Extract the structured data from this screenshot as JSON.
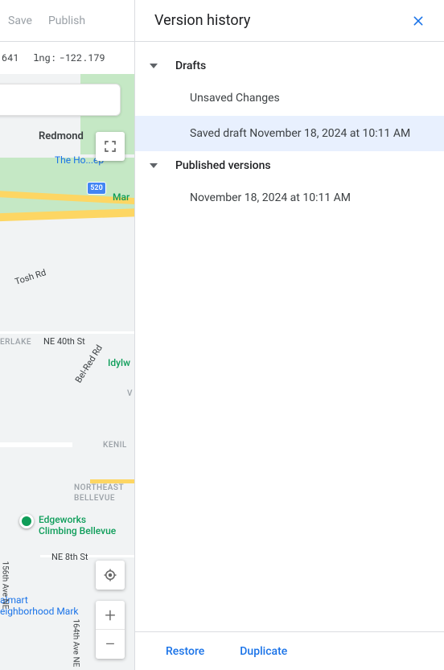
{
  "toolbar": {
    "save_label": "Save",
    "publish_label": "Publish"
  },
  "coords": {
    "lat_value": "641",
    "lng_label": "lng:",
    "lng_value": "-122.179"
  },
  "map": {
    "city": "Redmond",
    "poi_home_depot": "The Ho...ep",
    "poi_marymoor": "Mar",
    "route_520": "520",
    "road_tosh": "Tosh Rd",
    "neighborhood_erlake": "ERLAKE",
    "road_ne40": "NE 40th St",
    "road_belred": "Bel‑Red Rd",
    "poi_idylw": "Idylw",
    "neighborhood_v": "V",
    "neighborhood_kenil": "KENIL",
    "neighborhood_nebel": "NORTHEAST\nBELLEVUE",
    "poi_edgeworks_1": "Edgeworks",
    "poi_edgeworks_2": "Climbing Bellevue",
    "road_ne8": "NE 8th St",
    "poi_walmart_1": "almart",
    "poi_walmart_2": "eighborhood Mark",
    "road_156": "156th Ave NE",
    "road_164": "164th Ave NE"
  },
  "panel": {
    "title": "Version history",
    "sections": {
      "drafts": {
        "label": "Drafts",
        "items": [
          {
            "label": "Unsaved Changes"
          },
          {
            "label": "Saved draft November 18, 2024 at 10:11 AM"
          }
        ]
      },
      "published": {
        "label": "Published versions",
        "items": [
          {
            "label": "November 18, 2024 at 10:11 AM"
          }
        ]
      }
    },
    "footer": {
      "restore": "Restore",
      "duplicate": "Duplicate"
    }
  }
}
